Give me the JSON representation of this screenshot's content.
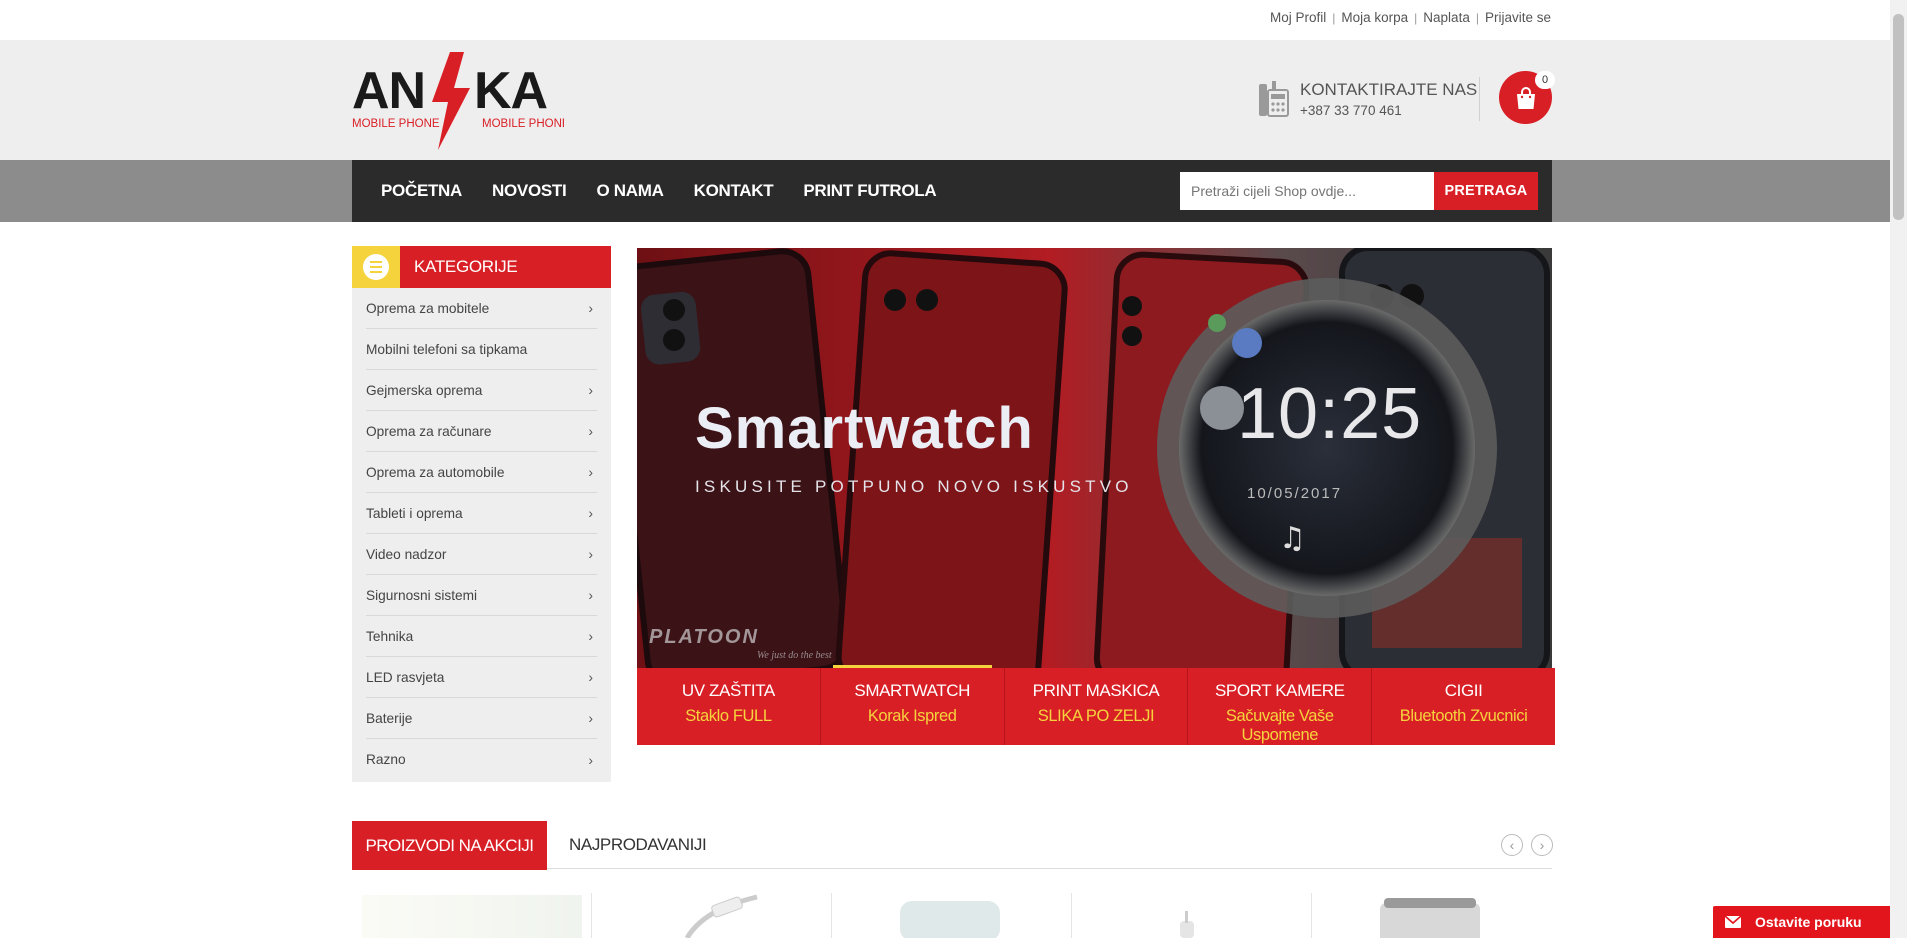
{
  "toplinks": [
    "Moj Profil",
    "Moja korpa",
    "Naplata",
    "Prijavite se"
  ],
  "logo": {
    "mark": "ANKA",
    "sub_left": "MOBILE PHONE",
    "sub_right": "MOBILE PHONE"
  },
  "contact": {
    "title": "KONTAKTIRAJTE NAS",
    "phone": "+387 33 770 461"
  },
  "cart": {
    "count": "0"
  },
  "nav": [
    "POČETNA",
    "NOVOSTI",
    "O NAMA",
    "KONTAKT",
    "PRINT FUTROLA"
  ],
  "search": {
    "placeholder": "Pretraži cijeli Shop ovdje...",
    "button": "PRETRAGA"
  },
  "sidebar": {
    "title": "KATEGORIJE",
    "items": [
      {
        "label": "Oprema za mobitele",
        "chevron": "›"
      },
      {
        "label": "Mobilni telefoni sa tipkama",
        "chevron": ""
      },
      {
        "label": "Gejmerska oprema",
        "chevron": "›"
      },
      {
        "label": "Oprema za računare",
        "chevron": "›"
      },
      {
        "label": "Oprema za automobile",
        "chevron": "›"
      },
      {
        "label": "Tableti i oprema",
        "chevron": "›"
      },
      {
        "label": "Video nadzor",
        "chevron": "›"
      },
      {
        "label": "Sigurnosni sistemi",
        "chevron": "›"
      },
      {
        "label": "Tehnika",
        "chevron": "›"
      },
      {
        "label": "LED rasvjeta",
        "chevron": "›"
      },
      {
        "label": "Baterije",
        "chevron": "›"
      },
      {
        "label": "Razno",
        "chevron": "›"
      }
    ]
  },
  "banner": {
    "headline": "Smartwatch",
    "subline": "ISKUSITE POTPUNO NOVO ISKUSTVO",
    "time": "10:25",
    "date": "10/05/2017",
    "brand": "PLATOON",
    "tagline": "We just do the best"
  },
  "slider_tabs": [
    {
      "title": "UV ZAŠTITA",
      "subtitle": "Staklo FULL"
    },
    {
      "title": "SMARTWATCH",
      "subtitle": "Korak Ispred"
    },
    {
      "title": "PRINT MASKICA",
      "subtitle": "SLIKA PO ZELJI"
    },
    {
      "title": "SPORT KAMERE",
      "subtitle": "Sačuvajte Vaše Uspomene"
    },
    {
      "title": "CIGII",
      "subtitle": "Bluetooth Zvucnici"
    }
  ],
  "product_tabs": {
    "active": "PROIZVODI NA AKCIJI",
    "other": "NAJPRODAVANIJI"
  },
  "message_button": "Ostavite poruku",
  "colors": {
    "brand_red": "#d91f26",
    "accent_yellow": "#f4d33c",
    "nav_dark": "#2b2b2b"
  }
}
